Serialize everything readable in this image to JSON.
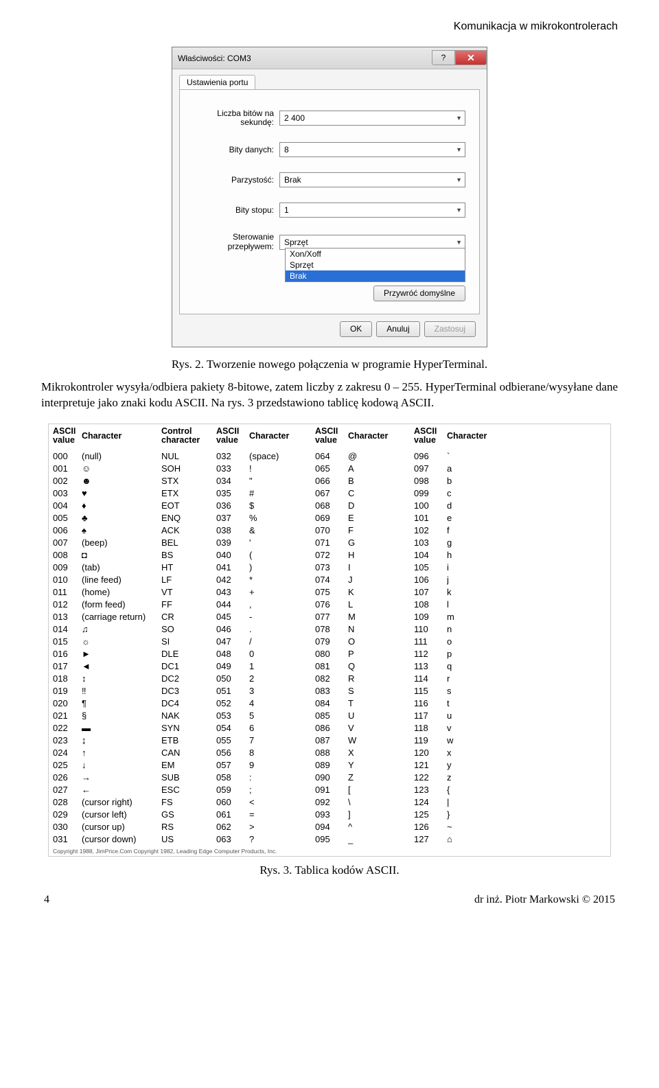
{
  "header": {
    "title": "Komunikacja w mikrokontrolerach"
  },
  "dialog": {
    "title": "Właściwości: COM3",
    "tab": "Ustawienia portu",
    "fields": {
      "baud_label": "Liczba bitów na sekundę:",
      "baud_value": "2 400",
      "databits_label": "Bity danych:",
      "databits_value": "8",
      "parity_label": "Parzystość:",
      "parity_value": "Brak",
      "stopbits_label": "Bity stopu:",
      "stopbits_value": "1",
      "flow_label": "Sterowanie przepływem:",
      "flow_value": "Sprzęt",
      "flow_options": [
        "Xon/Xoff",
        "Sprzęt",
        "Brak"
      ],
      "flow_selected": "Brak",
      "restore_label": "Przywróć domyślne"
    },
    "buttons": {
      "ok": "OK",
      "cancel": "Anuluj",
      "apply": "Zastosuj"
    }
  },
  "captions": {
    "fig2": "Rys. 2. Tworzenie nowego połączenia w programie HyperTerminal.",
    "fig3": "Rys. 3. Tablica kodów ASCII."
  },
  "paragraph": "Mikrokontroler wysyła/odbiera pakiety 8-bitowe, zatem liczby z zakresu 0 – 255. HyperTerminal odbierane/wysyłane dane interpretuje jako znaki kodu ASCII. Na rys. 3 przedstawiono tablicę kodową ASCII.",
  "ascii": {
    "head": [
      "ASCII value",
      "Character",
      "Control character",
      "ASCII value",
      "Character",
      "ASCII value",
      "Character",
      "ASCII value",
      "Character"
    ],
    "rows": [
      [
        "000",
        "(null)",
        "NUL",
        "032",
        "(space)",
        "064",
        "@",
        "096",
        "`"
      ],
      [
        "001",
        "☺",
        "SOH",
        "033",
        "!",
        "065",
        "A",
        "097",
        "a"
      ],
      [
        "002",
        "☻",
        "STX",
        "034",
        "\"",
        "066",
        "B",
        "098",
        "b"
      ],
      [
        "003",
        "♥",
        "ETX",
        "035",
        "#",
        "067",
        "C",
        "099",
        "c"
      ],
      [
        "004",
        "♦",
        "EOT",
        "036",
        "$",
        "068",
        "D",
        "100",
        "d"
      ],
      [
        "005",
        "♣",
        "ENQ",
        "037",
        "%",
        "069",
        "E",
        "101",
        "e"
      ],
      [
        "006",
        "♠",
        "ACK",
        "038",
        "&",
        "070",
        "F",
        "102",
        "f"
      ],
      [
        "007",
        "(beep)",
        "BEL",
        "039",
        "'",
        "071",
        "G",
        "103",
        "g"
      ],
      [
        "008",
        "◘",
        "BS",
        "040",
        "(",
        "072",
        "H",
        "104",
        "h"
      ],
      [
        "009",
        "(tab)",
        "HT",
        "041",
        ")",
        "073",
        "I",
        "105",
        "i"
      ],
      [
        "010",
        "(line feed)",
        "LF",
        "042",
        "*",
        "074",
        "J",
        "106",
        "j"
      ],
      [
        "011",
        "(home)",
        "VT",
        "043",
        "+",
        "075",
        "K",
        "107",
        "k"
      ],
      [
        "012",
        "(form feed)",
        "FF",
        "044",
        ",",
        "076",
        "L",
        "108",
        "l"
      ],
      [
        "013",
        "(carriage return)",
        "CR",
        "045",
        "-",
        "077",
        "M",
        "109",
        "m"
      ],
      [
        "014",
        "♫",
        "SO",
        "046",
        ".",
        "078",
        "N",
        "110",
        "n"
      ],
      [
        "015",
        "☼",
        "SI",
        "047",
        "/",
        "079",
        "O",
        "111",
        "o"
      ],
      [
        "016",
        "►",
        "DLE",
        "048",
        "0",
        "080",
        "P",
        "112",
        "p"
      ],
      [
        "017",
        "◄",
        "DC1",
        "049",
        "1",
        "081",
        "Q",
        "113",
        "q"
      ],
      [
        "018",
        "↕",
        "DC2",
        "050",
        "2",
        "082",
        "R",
        "114",
        "r"
      ],
      [
        "019",
        "‼",
        "DC3",
        "051",
        "3",
        "083",
        "S",
        "115",
        "s"
      ],
      [
        "020",
        "¶",
        "DC4",
        "052",
        "4",
        "084",
        "T",
        "116",
        "t"
      ],
      [
        "021",
        "§",
        "NAK",
        "053",
        "5",
        "085",
        "U",
        "117",
        "u"
      ],
      [
        "022",
        "▬",
        "SYN",
        "054",
        "6",
        "086",
        "V",
        "118",
        "v"
      ],
      [
        "023",
        "↨",
        "ETB",
        "055",
        "7",
        "087",
        "W",
        "119",
        "w"
      ],
      [
        "024",
        "↑",
        "CAN",
        "056",
        "8",
        "088",
        "X",
        "120",
        "x"
      ],
      [
        "025",
        "↓",
        "EM",
        "057",
        "9",
        "089",
        "Y",
        "121",
        "y"
      ],
      [
        "026",
        "→",
        "SUB",
        "058",
        ":",
        "090",
        "Z",
        "122",
        "z"
      ],
      [
        "027",
        "←",
        "ESC",
        "059",
        ";",
        "091",
        "[",
        "123",
        "{"
      ],
      [
        "028",
        "(cursor right)",
        "FS",
        "060",
        "<",
        "092",
        "\\",
        "124",
        "|"
      ],
      [
        "029",
        "(cursor left)",
        "GS",
        "061",
        "=",
        "093",
        "]",
        "125",
        "}"
      ],
      [
        "030",
        "(cursor up)",
        "RS",
        "062",
        ">",
        "094",
        "^",
        "126",
        "~"
      ],
      [
        "031",
        "(cursor down)",
        "US",
        "063",
        "?",
        "095",
        "_",
        "127",
        "⌂"
      ]
    ],
    "copyright": "Copyright 1988, JimPrice.Com  Copyright 1982, Leading Edge Computer Products, Inc."
  },
  "footer": {
    "page": "4",
    "author": "dr inż. Piotr Markowski © 2015"
  }
}
